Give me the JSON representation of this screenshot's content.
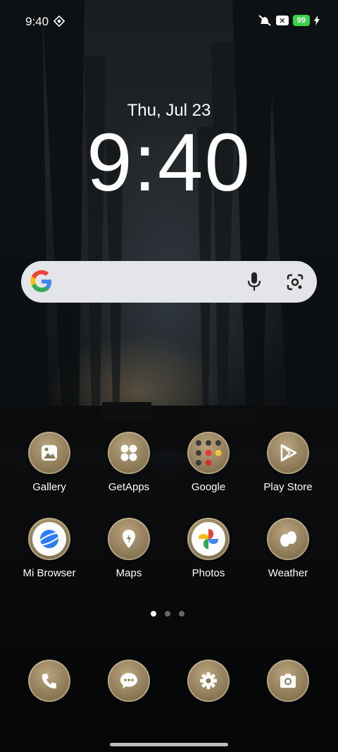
{
  "status_bar": {
    "time": "9:40",
    "battery": "99",
    "icons": [
      "data-saver-icon",
      "vibrate-off-icon",
      "x-notification-icon",
      "battery-icon",
      "charging-icon"
    ]
  },
  "lockscreen": {
    "date": "Thu, Jul 23",
    "clock": "9:40"
  },
  "search_widget": {
    "icons": [
      "google-logo-icon",
      "mic-icon",
      "lens-icon"
    ]
  },
  "apps_row1": [
    {
      "label": "Gallery",
      "icon": "gallery-icon"
    },
    {
      "label": "GetApps",
      "icon": "getapps-icon"
    },
    {
      "label": "Google",
      "icon": "google-folder-icon"
    },
    {
      "label": "Play Store",
      "icon": "play-store-icon"
    }
  ],
  "apps_row2": [
    {
      "label": "Mi Browser",
      "icon": "mi-browser-icon"
    },
    {
      "label": "Maps",
      "icon": "maps-icon"
    },
    {
      "label": "Photos",
      "icon": "photos-icon"
    },
    {
      "label": "Weather",
      "icon": "weather-icon"
    }
  ],
  "dock": [
    {
      "icon": "phone-icon"
    },
    {
      "icon": "messages-icon"
    },
    {
      "icon": "settings-icon"
    },
    {
      "icon": "camera-icon"
    }
  ],
  "pager": {
    "pages": 3,
    "active": 1
  }
}
